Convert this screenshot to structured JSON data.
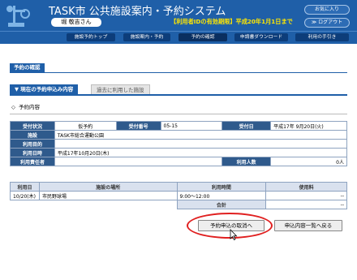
{
  "header": {
    "title": "TASK市  公共施設案内・予約システム",
    "user": "堀  敬吉さん",
    "notice": "【利用者IDの有効期限】平成20年1月1日まで",
    "favorites": "お気に入り",
    "logout": "≫ ログアウト"
  },
  "nav": {
    "items": [
      "施設予約トップ",
      "施設案内・予約",
      "予約の確認",
      "申請書ダウンロード",
      "利用の手引き"
    ]
  },
  "page": {
    "title": "予約の確認",
    "tab_current": "▼ 現在の予約申込み内容",
    "tab_past": "過去に利用した施設",
    "subsection": "予約内容",
    "subsection_icon": "◇"
  },
  "reservation": {
    "status_label": "受付状況",
    "status_value": "仮予約",
    "number_label": "受付番号",
    "number_value": "05-15",
    "date_label": "受付日",
    "date_value": "平成17年 9月20日(火)",
    "facility_label": "施設",
    "facility_value": "TASK市総合運動公園",
    "purpose_label": "利用目的",
    "purpose_value": "",
    "usedate_label": "利用日時",
    "usedate_value": "平成17年10月20日(木)",
    "responsible_label": "利用責任者",
    "responsible_value": "",
    "people_label": "利用人数",
    "people_value": "0人"
  },
  "usage_table": {
    "headers": [
      "利用日",
      "施設の場所",
      "利用時間",
      "使用料"
    ],
    "rows": [
      {
        "date": "10/20(木)",
        "place": "市民野球場",
        "time": "9:00～12:00",
        "fee": "--"
      }
    ],
    "total_label": "合計",
    "total_value": "--"
  },
  "buttons": {
    "cancel": "予約申込の取消へ",
    "list": "申込内容一覧へ戻る"
  },
  "colors": {
    "header_blue": "#1f5fa8",
    "notice_yellow": "#ffe700",
    "table_header": "#2f5a8c",
    "highlight_red": "#e02020"
  }
}
